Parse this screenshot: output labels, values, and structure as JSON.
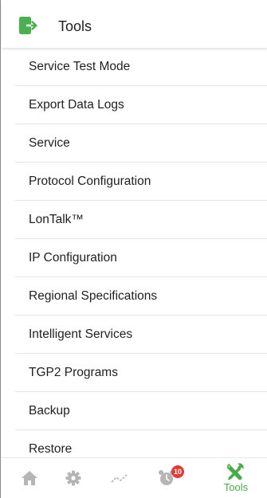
{
  "header": {
    "title": "Tools",
    "icon": "exit-arrow-icon",
    "accent_color": "#4caf50"
  },
  "menu": {
    "items": [
      {
        "label": "Service Test Mode"
      },
      {
        "label": "Export Data Logs"
      },
      {
        "label": "Service"
      },
      {
        "label": "Protocol Configuration"
      },
      {
        "label": "LonTalk™"
      },
      {
        "label": "IP Configuration"
      },
      {
        "label": "Regional Specifications"
      },
      {
        "label": "Intelligent Services"
      },
      {
        "label": "TGP2 Programs"
      },
      {
        "label": "Backup"
      },
      {
        "label": "Restore"
      }
    ]
  },
  "bottom_nav": {
    "items": [
      {
        "icon": "home-icon",
        "active": false
      },
      {
        "icon": "gear-icon",
        "active": false
      },
      {
        "icon": "trend-icon",
        "active": false
      },
      {
        "icon": "alarm-clock-icon",
        "active": false,
        "badge": "10"
      },
      {
        "icon": "tools-icon",
        "label": "Tools",
        "active": true
      }
    ],
    "inactive_color": "#b5b5b5",
    "active_color": "#4aaa4a",
    "badge_color": "#e53935"
  }
}
